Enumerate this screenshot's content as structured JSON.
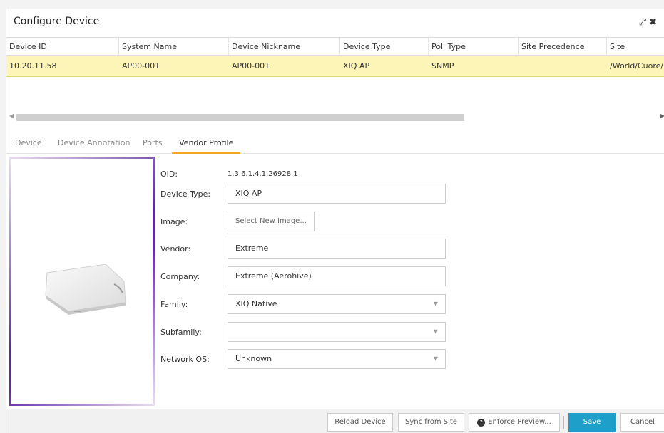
{
  "window": {
    "title": "Configure Device",
    "icons": [
      "expand-icon",
      "close-icon"
    ]
  },
  "grid": {
    "columns": [
      "Device ID",
      "System Name",
      "Device Nickname",
      "Device Type",
      "Poll Type",
      "Site Precedence",
      "Site"
    ],
    "rows": [
      [
        "10.20.11.58",
        "AP00-001",
        "AP00-001",
        "XIQ AP",
        "SNMP",
        "",
        "/World/Cuore/"
      ]
    ]
  },
  "tabs": [
    "Device",
    "Device Annotation",
    "Ports",
    "Vendor Profile"
  ],
  "active_tab": "Vendor Profile",
  "form": {
    "oid_label": "OID:",
    "oid_value": "1.3.6.1.4.1.26928.1",
    "device_type_label": "Device Type:",
    "device_type_value": "XIQ AP",
    "image_label": "Image:",
    "image_button": "Select New Image...",
    "vendor_label": "Vendor:",
    "vendor_value": "Extreme",
    "company_label": "Company:",
    "company_value": "Extreme (Aerohive)",
    "family_label": "Family:",
    "family_value": "XIQ Native",
    "subfamily_label": "Subfamily:",
    "subfamily_value": "",
    "network_os_label": "Network OS:",
    "network_os_value": "Unknown"
  },
  "footer": {
    "reload": "Reload Device",
    "sync": "Sync from Site",
    "enforce": "Enforce Preview...",
    "save": "Save",
    "cancel": "Cancel"
  },
  "colors": {
    "accent": "#1d9fc9",
    "selected_row": "#fdf5b8",
    "tab_underline": "#f0a820"
  }
}
